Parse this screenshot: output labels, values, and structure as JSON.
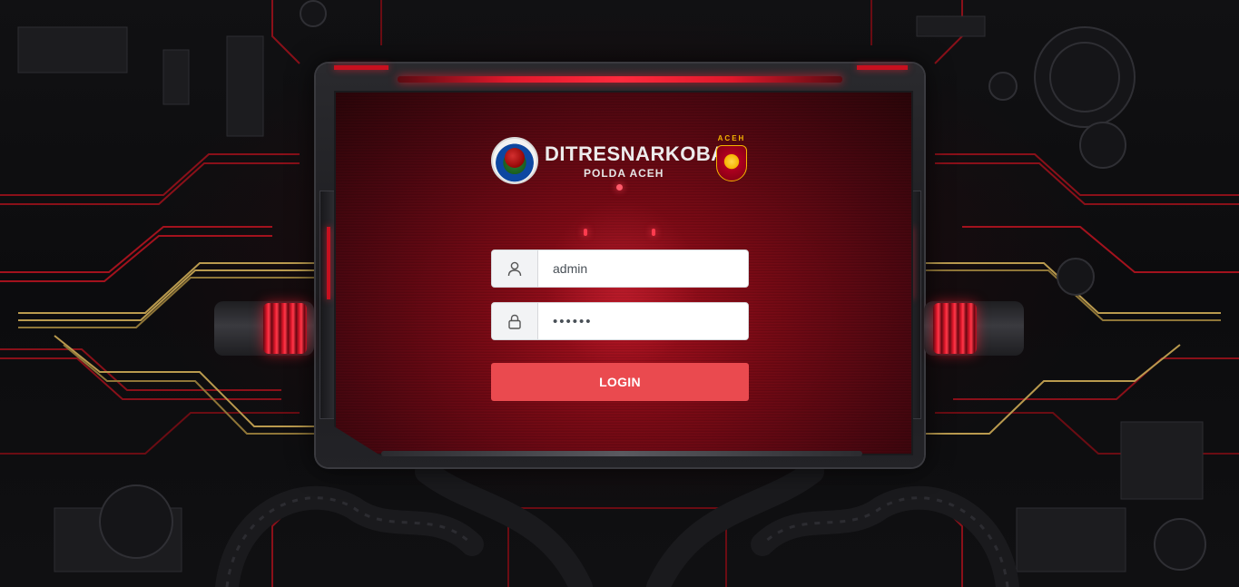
{
  "brand": {
    "title": "DITRESNARKOBA",
    "subtitle": "POLDA ACEH",
    "badge_text": "ACEH"
  },
  "login_form": {
    "username": {
      "icon": "user-icon",
      "value": "admin"
    },
    "password": {
      "icon": "lock-icon",
      "value": "••••••"
    },
    "submit_label": "LOGIN"
  },
  "colors": {
    "login_button": "#ea4a4f",
    "screen_red": "#7a0a15",
    "accent_red": "#e0182b",
    "badge_gold": "#f5b400"
  }
}
